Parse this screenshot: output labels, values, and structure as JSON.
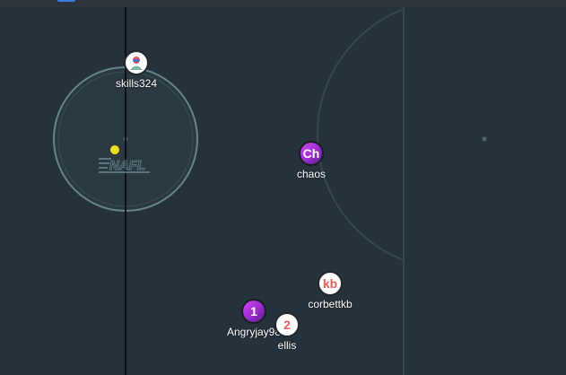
{
  "colors": {
    "field": "#26323b",
    "line_dark": "#0e1114",
    "line_light": "#7fa6ad",
    "arc": "#37505a",
    "ball": "#e6e02a"
  },
  "logo": {
    "text": "NAFL"
  },
  "players": [
    {
      "id": "skills324",
      "name": "skills324",
      "avatar_text": "",
      "avatar_style": "icon"
    },
    {
      "id": "chaos",
      "name": "chaos",
      "avatar_text": "Ch",
      "avatar_style": "purple"
    },
    {
      "id": "corbettkb",
      "name": "corbettkb",
      "avatar_text": "kb",
      "avatar_style": "white"
    },
    {
      "id": "angryjay",
      "name": "Angryjay98",
      "avatar_text": "1",
      "avatar_style": "purple"
    },
    {
      "id": "ellis",
      "name": "ellis",
      "avatar_text": "2",
      "avatar_style": "white"
    }
  ]
}
